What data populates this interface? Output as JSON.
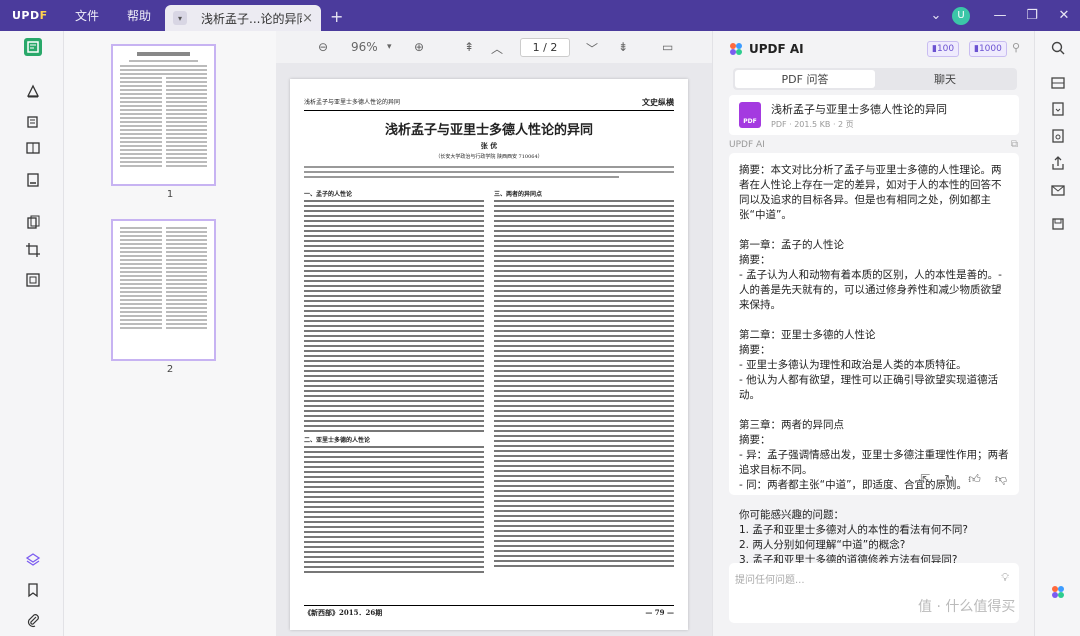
{
  "app": {
    "logo": "UPDF",
    "menu": [
      "文件",
      "帮助"
    ],
    "tab_label": "浅析孟子...论的异同",
    "new_tab": "+",
    "avatar_letter": "U"
  },
  "viewer": {
    "zoom": "96%",
    "page_indicator": "1 / 2"
  },
  "thumbnails": [
    {
      "number": "1"
    },
    {
      "number": "2"
    }
  ],
  "document": {
    "running_head_left": "浅析孟子与亚里士多德人性论的异同",
    "running_head_right": "文史纵横",
    "title": "浅析孟子与亚里士多德人性论的异同",
    "author": "张 优",
    "affiliation": "（长安大学政治与行政学院  陕西西安  710064）",
    "section_1": "一、孟子的人性论",
    "section_2": "二、亚里士多德的人性论",
    "section_3": "三、两者的异同点",
    "footer_left": "《新西部》2015．26期",
    "footer_right": "— 79 —"
  },
  "ai": {
    "title": "UPDF AI",
    "credit_1": "100",
    "credit_2": "1000",
    "tabs": [
      "PDF 问答",
      "聊天"
    ],
    "file_name": "浅析孟子与亚里士多德人性论的异同",
    "file_info": "PDF · 201.5 KB · 2 页",
    "label": "UPDF AI",
    "answer_lines": [
      "摘要：本文对比分析了孟子与亚里士多德的人性理论。两者在人性论上存在一定的差异，如对于人的本性的回答不同以及追求的目标各异。但是也有相同之处，例如都主张“中道”。",
      "",
      "第一章：孟子的人性论",
      "摘要：",
      "- 孟子认为人和动物有着本质的区别，人的本性是善的。- 人的善是先天就有的，可以通过修身养性和减少物质欲望来保持。",
      "",
      "第二章：亚里士多德的人性论",
      "摘要：",
      "- 亚里士多德认为理性和政治是人类的本质特征。",
      "- 他认为人都有欲望，理性可以正确引导欲望实现道德活动。",
      "",
      "第三章：两者的异同点",
      "摘要：",
      "- 异：孟子强调情感出发，亚里士多德注重理性作用；两者追求目标不同。",
      "- 同：两者都主张“中道”，即适度、合宜的原则。",
      "",
      "你可能感兴趣的问题：",
      "1. 孟子和亚里士多德对人的本性的看法有何不同?",
      "2. 两人分别如何理解“中道”的概念?",
      "3. 孟子和亚里士多德的道德修养方法有何异同?"
    ],
    "input_placeholder": "提问任何问题..."
  },
  "watermark": "值 · 什么值得买",
  "colors": {
    "titlebar": "#4b3b9c",
    "accent": "#7b5cf0",
    "pdf_icon": "#a43ae0"
  }
}
